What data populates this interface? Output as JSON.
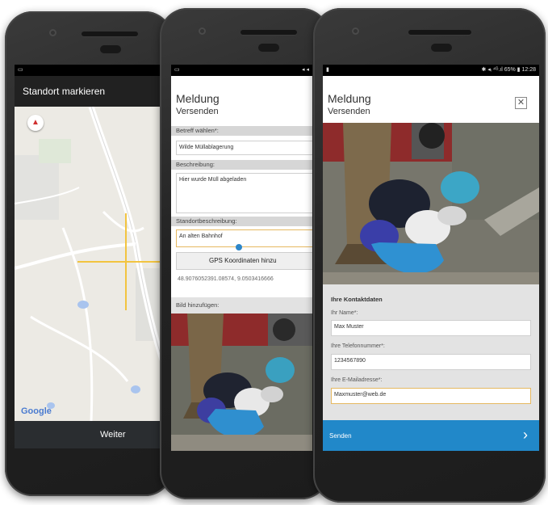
{
  "phone1": {
    "status_icons": "▮ ▾ ◂",
    "header_title": "Standort markieren",
    "compass_icon": "compass-icon",
    "map_attribution": "Google",
    "next_button": "Weiter",
    "crosshair_color": "#f2c440"
  },
  "phone2": {
    "status_icons": "◂ ◂",
    "title": "Meldung",
    "subtitle": "Versenden",
    "subject_label": "Betreff wählen*:",
    "subject_value": "Wilde Müllablagerung",
    "description_label": "Beschreibung:",
    "description_value": "Hier wurde Müll abgeladen",
    "location_label": "Standortbeschreibung:",
    "location_value": "An alten Bahnhof",
    "gps_button": "GPS Koordinaten hinzu",
    "coordinates": "48.9076052391.08574, 9.0503416666",
    "image_label": "Bild hinzufügen:"
  },
  "phone3": {
    "status_left": "▮",
    "status_right": "✱ ◂ᵢ ⁴ᴳ.ıl 65% ▮ 12:28",
    "title": "Meldung",
    "subtitle": "Versenden",
    "contact_header": "Ihre Kontaktdaten",
    "name_label": "Ihr Name*:",
    "name_value": "Max Muster",
    "phone_label": "Ihre Telefonnummer*:",
    "phone_value": "1234567890",
    "email_label": "Ihre E-Mailadresse*:",
    "email_value": "Maxmuster@web.de",
    "send_button": "Senden",
    "send_color": "#2188c9"
  }
}
